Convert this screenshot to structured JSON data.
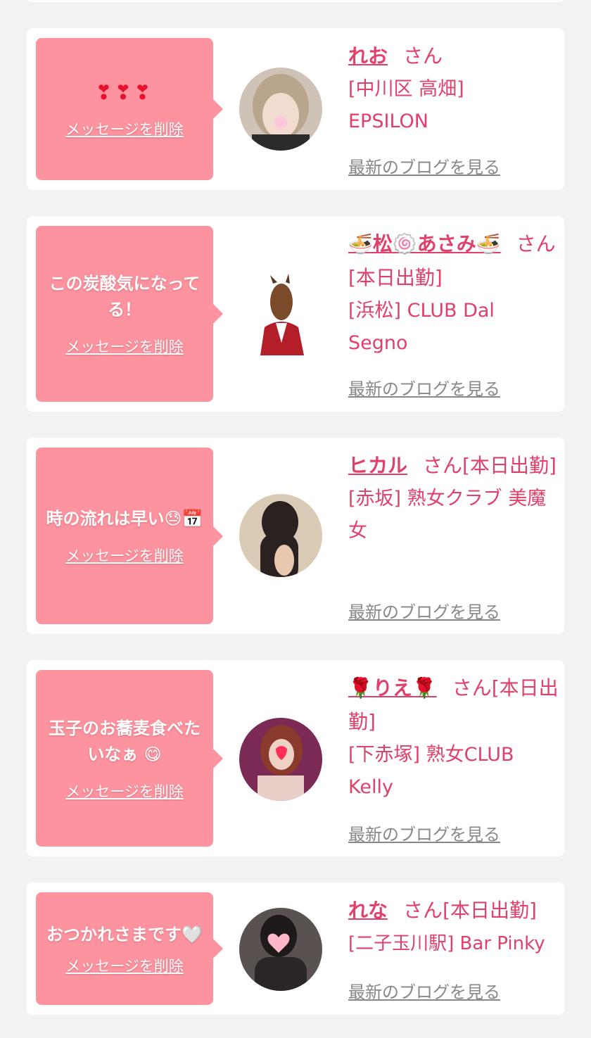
{
  "delete_label": "メッセージを削除",
  "blog_label": "最新のブログを見る",
  "items": [
    {
      "message": "❣❣❣",
      "name": "れお",
      "suffix": "さん",
      "shop": "[中川区 高畑] EPSILON"
    },
    {
      "message": "この炭酸気になってる！",
      "name": "🍜松🍥あさみ🍜",
      "suffix": "さん[本日出勤]",
      "shop": "[浜松] CLUB Dal Segno"
    },
    {
      "message": "時の流れは早い😓📅",
      "name": "ヒカル",
      "suffix": "さん[本日出勤]",
      "shop": "[赤坂] 熟女クラブ 美魔女"
    },
    {
      "message": "玉子のお蕎麦食べたいなぁ 😋",
      "name": "🌹りえ🌹",
      "suffix": "さん[本日出勤]",
      "shop": "[下赤塚] 熟女CLUB Kelly"
    },
    {
      "message": "おつかれさまです🤍",
      "name": "れな",
      "suffix": "さん[本日出勤]",
      "shop": "[二子玉川駅] Bar Pinky"
    }
  ],
  "colors": {
    "page_bg": "#f2f2f2",
    "bubble": "#fd939f",
    "accent": "#e0406a",
    "link_gray": "#888888"
  }
}
